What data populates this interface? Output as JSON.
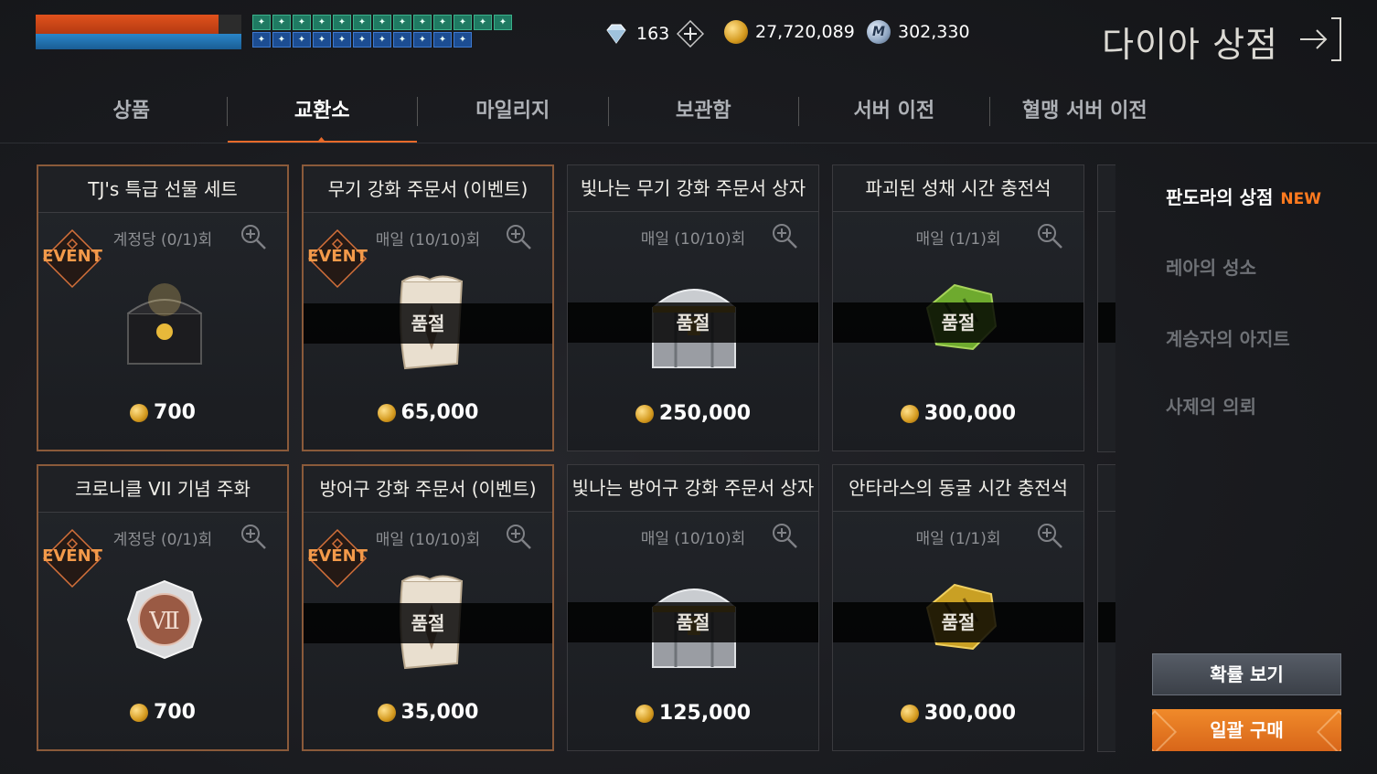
{
  "player": {
    "hp_pct": 0.89,
    "mp_pct": 1.0
  },
  "buffs_row1": [
    "✦",
    "✦",
    "✦",
    "✦",
    "✦",
    "✦",
    "✦",
    "✦",
    "✦",
    "✦",
    "✦",
    "✦",
    "✦"
  ],
  "buffs_row2": [
    "✦",
    "✦",
    "✦",
    "✦",
    "✦",
    "✦",
    "✦",
    "✦",
    "✦",
    "✦",
    "✦",
    "",
    ""
  ],
  "currency": {
    "diamonds": "163",
    "adena": "27,720,089",
    "medals": "302,330",
    "medal_glyph": "M"
  },
  "shop_title": "다이아 상점",
  "tabs": [
    "상품",
    "교환소",
    "마일리지",
    "보관함",
    "서버 이전",
    "혈맹 서버 이전"
  ],
  "active_tab": 1,
  "cards": [
    {
      "title": "TJ's 특급 선물 세트",
      "limit": "계정당 (0/1)회",
      "event": true,
      "soldout": false,
      "price": "700",
      "item": "black-chest",
      "event_label": "EVENT"
    },
    {
      "title": "무기 강화 주문서 (이벤트)",
      "limit": "매일 (10/10)회",
      "event": true,
      "soldout": true,
      "price": "65,000",
      "item": "scroll",
      "event_label": "EVENT"
    },
    {
      "title": "빛나는 무기 강화 주문서 상자",
      "limit": "매일 (10/10)회",
      "event": false,
      "soldout": true,
      "price": "250,000",
      "item": "silver-chest"
    },
    {
      "title": "파괴된 성채 시간 충전석",
      "limit": "매일 (1/1)회",
      "event": false,
      "soldout": true,
      "price": "300,000",
      "item": "green-stone"
    },
    {
      "title": "크로니클 VII 기념 주화",
      "limit": "계정당 (0/1)회",
      "event": true,
      "soldout": false,
      "price": "700",
      "item": "silver-coin",
      "event_label": "EVENT"
    },
    {
      "title": "방어구 강화 주문서 (이벤트)",
      "limit": "매일 (10/10)회",
      "event": true,
      "soldout": true,
      "price": "35,000",
      "item": "scroll",
      "event_label": "EVENT"
    },
    {
      "title": "빛나는 방어구 강화 주문서 상자",
      "limit": "매일 (10/10)회",
      "event": false,
      "soldout": true,
      "price": "125,000",
      "item": "silver-chest"
    },
    {
      "title": "안타라스의 동굴 시간 충전석",
      "limit": "매일 (1/1)회",
      "event": false,
      "soldout": true,
      "price": "300,000",
      "item": "gold-stone"
    }
  ],
  "soldout_label": "품절",
  "side_menu": [
    {
      "label": "판도라의 상점",
      "badge": "NEW",
      "active": true
    },
    {
      "label": "레아의 성소",
      "active": false
    },
    {
      "label": "계승자의 아지트",
      "active": false
    },
    {
      "label": "사제의 의뢰",
      "active": false
    }
  ],
  "buttons": {
    "probability": "확률 보기",
    "bulk_buy": "일괄 구매"
  },
  "colors": {
    "accent": "#e86a2a",
    "event_border": "#8a5a3a",
    "hp": "#e0521c",
    "mp": "#2a86c9"
  }
}
